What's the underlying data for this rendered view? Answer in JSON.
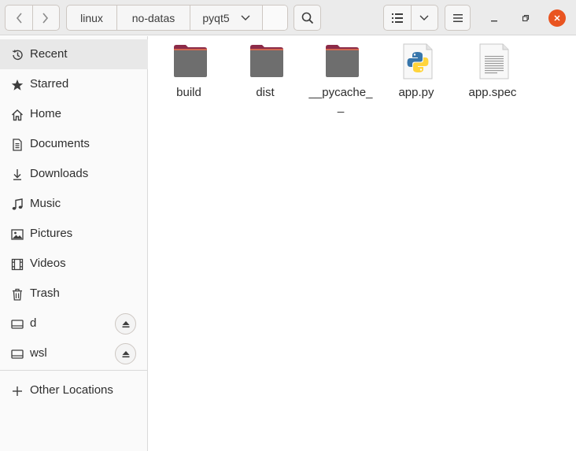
{
  "header": {
    "back_icon": "chevron-left-icon",
    "forward_icon": "chevron-right-icon",
    "path": [
      "linux",
      "no-datas",
      "pyqt5"
    ]
  },
  "sidebar": {
    "items": [
      {
        "label": "Recent",
        "icon": "clock-icon"
      },
      {
        "label": "Starred",
        "icon": "star-icon"
      },
      {
        "label": "Home",
        "icon": "home-icon"
      },
      {
        "label": "Documents",
        "icon": "document-icon"
      },
      {
        "label": "Downloads",
        "icon": "download-icon"
      },
      {
        "label": "Music",
        "icon": "music-icon"
      },
      {
        "label": "Pictures",
        "icon": "picture-icon"
      },
      {
        "label": "Videos",
        "icon": "video-icon"
      },
      {
        "label": "Trash",
        "icon": "trash-icon"
      },
      {
        "label": "d",
        "icon": "drive-icon"
      },
      {
        "label": "wsl",
        "icon": "drive-icon"
      }
    ],
    "other_locations": "Other Locations"
  },
  "files": [
    {
      "name": "build",
      "type": "folder"
    },
    {
      "name": "dist",
      "type": "folder"
    },
    {
      "name": "__pycache__",
      "type": "folder"
    },
    {
      "name": "app.py",
      "type": "python"
    },
    {
      "name": "app.spec",
      "type": "text"
    }
  ],
  "colors": {
    "accent": "#e95420",
    "folder_tab": "#8c2b48",
    "folder_body": "#6e6e6e"
  }
}
